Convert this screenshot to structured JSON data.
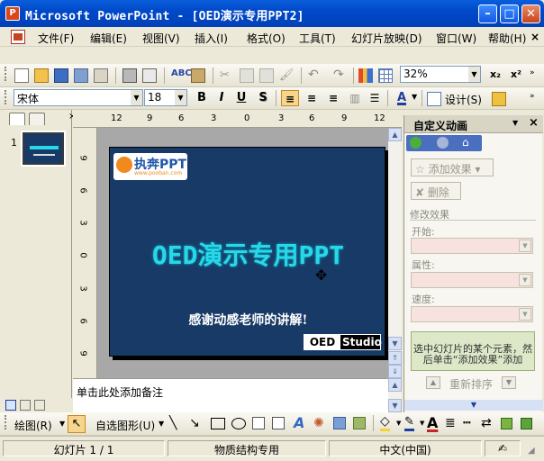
{
  "window": {
    "title": "Microsoft PowerPoint - [OED演示专用PPT2]",
    "icon": "powerpoint-icon"
  },
  "menu": [
    "文件(F)",
    "编辑(E)",
    "视图(V)",
    "插入(I)",
    "格式(O)",
    "工具(T)",
    "幻灯片放映(D)",
    "窗口(W)",
    "帮助(H)"
  ],
  "standard_toolbar": {
    "zoom": "32%"
  },
  "format_toolbar": {
    "font": "宋体",
    "size": "18",
    "bold": "B",
    "italic": "I",
    "underline": "U",
    "shadow": "S",
    "font_color_label": "A",
    "design_label": "设计(S)"
  },
  "left_panel": {
    "slide_number": "1"
  },
  "rulers": {
    "horizontal": [
      "12",
      "9",
      "6",
      "3",
      "0",
      "3",
      "6",
      "9",
      "12"
    ],
    "vertical": [
      "9",
      "6",
      "3",
      "0",
      "3",
      "6",
      "9"
    ]
  },
  "slide": {
    "logo_text": "执奔PPT",
    "logo_sub": "www.pooban.com",
    "title": "OED演示专用PPT",
    "subtitle": "感谢动感老师的讲解!",
    "badge_oed": "OED",
    "badge_studio": "Studio"
  },
  "notes": {
    "placeholder": "单击此处添加备注"
  },
  "task_pane": {
    "title": "自定义动画",
    "add_effect": "添加效果",
    "remove": "删除",
    "modify_header": "修改效果",
    "start_label": "开始:",
    "property_label": "属性:",
    "speed_label": "速度:",
    "hint": "选中幻灯片的某个元素，然后单击“添加效果”添加",
    "reorder": "重新排序"
  },
  "drawing_toolbar": {
    "draw_label": "绘图(R)",
    "autoshapes_label": "自选图形(U)"
  },
  "status_bar": {
    "slide": "幻灯片 1 / 1",
    "design": "物质结构专用",
    "language": "中文(中国)"
  },
  "colors": {
    "slide_bg": "#183A66",
    "title_color": "#27D9E8",
    "titlebar": "#0A5EDB"
  }
}
